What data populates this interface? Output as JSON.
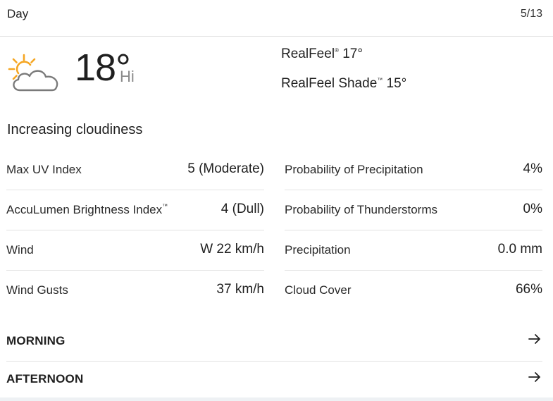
{
  "header": {
    "title": "Day",
    "date": "5/13"
  },
  "current": {
    "icon": "partly-sunny-cloud-icon",
    "temperature": "18°",
    "temp_label": "Hi",
    "realfeel_label": "RealFeel",
    "realfeel_value": "17°",
    "realfeel_shade_label": "RealFeel Shade",
    "realfeel_shade_value": "15°",
    "phrase": "Increasing cloudiness"
  },
  "details_left": [
    {
      "label": "Max UV Index",
      "value": "5 (Moderate)"
    },
    {
      "label": "AccuLumen Brightness Index",
      "value": "4 (Dull)"
    },
    {
      "label": "Wind",
      "value": "W 22 km/h"
    },
    {
      "label": "Wind Gusts",
      "value": "37 km/h"
    }
  ],
  "details_right": [
    {
      "label": "Probability of Precipitation",
      "value": "4%"
    },
    {
      "label": "Probability of Thunderstorms",
      "value": "0%"
    },
    {
      "label": "Precipitation",
      "value": "0.0 mm"
    },
    {
      "label": "Cloud Cover",
      "value": "66%"
    }
  ],
  "sections": {
    "morning": "MORNING",
    "afternoon": "AFTERNOON"
  },
  "colors": {
    "sun": "#f5a623",
    "cloud_stroke": "#7a7a7a",
    "divider": "#e2e2e2"
  }
}
